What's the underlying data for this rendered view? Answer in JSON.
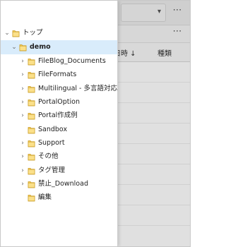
{
  "background": {
    "more_label": "⋯",
    "dropdown_caret": "▾",
    "columns": {
      "date": "新日時 ↓",
      "type": "種類"
    }
  },
  "tree": {
    "items": [
      {
        "label": "トップ",
        "expander": "⌄",
        "bold": false,
        "selected": false,
        "level": 0
      },
      {
        "label": "demo",
        "expander": "⌄",
        "bold": true,
        "selected": true,
        "level": 1
      },
      {
        "label": "FileBlog_Documents",
        "expander": "›",
        "bold": false,
        "selected": false,
        "level": 2
      },
      {
        "label": "FileFormats",
        "expander": "›",
        "bold": false,
        "selected": false,
        "level": 2
      },
      {
        "label": "Multilingual - 多言語対応 -",
        "expander": "›",
        "bold": false,
        "selected": false,
        "level": 2
      },
      {
        "label": "PortalOption",
        "expander": "›",
        "bold": false,
        "selected": false,
        "level": 2
      },
      {
        "label": "Portal作成例",
        "expander": "›",
        "bold": false,
        "selected": false,
        "level": 2
      },
      {
        "label": "Sandbox",
        "expander": "",
        "bold": false,
        "selected": false,
        "level": 2
      },
      {
        "label": "Support",
        "expander": "›",
        "bold": false,
        "selected": false,
        "level": 2
      },
      {
        "label": "その他",
        "expander": "›",
        "bold": false,
        "selected": false,
        "level": 2
      },
      {
        "label": "タグ管理",
        "expander": "›",
        "bold": false,
        "selected": false,
        "level": 2
      },
      {
        "label": "禁止_Download",
        "expander": "›",
        "bold": false,
        "selected": false,
        "level": 2
      },
      {
        "label": "編集",
        "expander": "",
        "bold": false,
        "selected": false,
        "level": 2
      }
    ]
  },
  "colors": {
    "selection": "#d9ecfb",
    "folder_fill": "#f6cc58",
    "folder_stroke": "#c99b22"
  }
}
